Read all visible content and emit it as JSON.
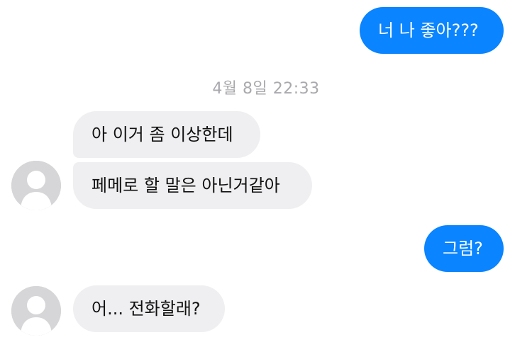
{
  "conversation": {
    "messages": [
      {
        "sender": "me",
        "text": "너 나 좋아???"
      },
      {
        "sender": "them",
        "text": "아 이거 좀 이상한데"
      },
      {
        "sender": "them",
        "text": "페메로 할 말은 아닌거같아"
      },
      {
        "sender": "me",
        "text": "그럼?"
      },
      {
        "sender": "them",
        "text": "어... 전화할래?"
      }
    ],
    "timestamp": "4월 8일 22:33"
  },
  "colors": {
    "outgoing_bubble": "#0a84ff",
    "incoming_bubble": "#efeff1",
    "timestamp_text": "#a9a9ad",
    "avatar_placeholder": "#d6d6d8"
  },
  "icons": {
    "avatar": "default-profile-silhouette-icon"
  }
}
